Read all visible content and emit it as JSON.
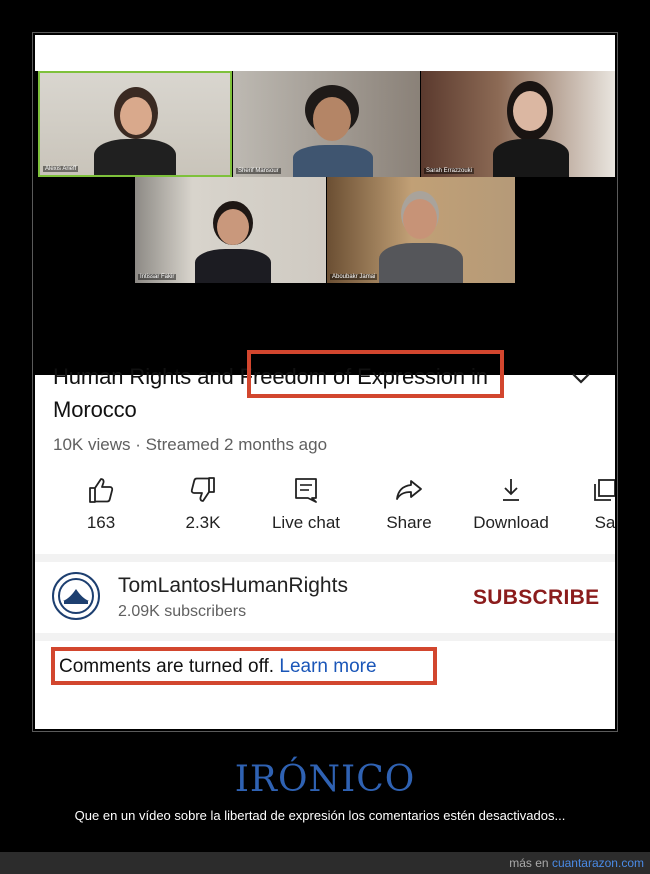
{
  "video": {
    "participants": [
      {
        "name": "Alexis Arieff"
      },
      {
        "name": "Sherif Mansour"
      },
      {
        "name": "Sarah Errazzouki"
      },
      {
        "name": "Intissar Fakir"
      },
      {
        "name": "Aboubakr Jamai"
      }
    ]
  },
  "video_info": {
    "title_part1": "Human Rights and ",
    "title_highlight": "Freedom of Expression",
    "title_part2": " in Morocco",
    "meta": "10K views · Streamed 2 months ago"
  },
  "actions": [
    {
      "label": "163",
      "icon": "thumbs-up-icon"
    },
    {
      "label": "2.3K",
      "icon": "thumbs-down-icon"
    },
    {
      "label": "Live chat",
      "icon": "chat-icon"
    },
    {
      "label": "Share",
      "icon": "share-icon"
    },
    {
      "label": "Download",
      "icon": "download-icon"
    },
    {
      "label": "Sa",
      "icon": "save-icon"
    }
  ],
  "channel": {
    "name": "TomLantosHumanRights",
    "subscribers": "2.09K subscribers",
    "subscribe_label": "SUBSCRIBE"
  },
  "comments": {
    "text": "Comments are turned off.",
    "link": "Learn more"
  },
  "caption": {
    "title": "IRÓNICO",
    "text": "Que en un vídeo sobre la libertad de expresión los comentarios estén desactivados..."
  },
  "footer": {
    "prefix": "más en ",
    "site": "cuantarazon.com"
  },
  "colors": {
    "highlight": "#d2462e",
    "subscribe": "#8b1c1c",
    "link": "#1a56b8",
    "caption_title": "#2f62b3"
  }
}
